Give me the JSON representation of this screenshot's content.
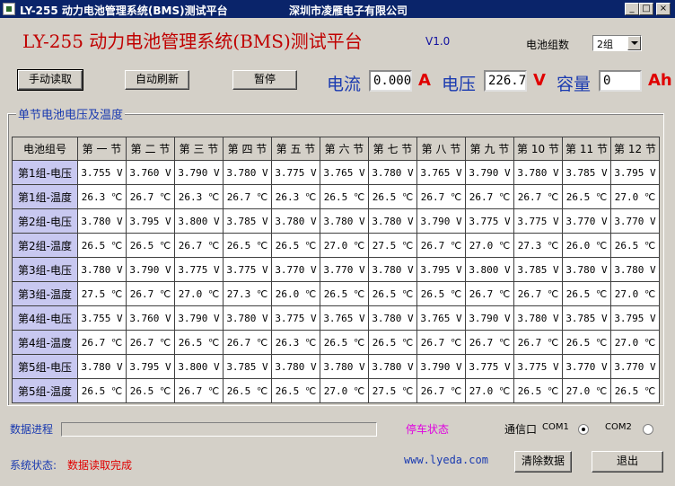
{
  "window": {
    "title": "LY-255 动力电池管理系统(BMS)测试平台",
    "company": "深圳市凌雁电子有限公司",
    "minimize": "_",
    "maximize": "□",
    "close": "×"
  },
  "header": {
    "big_title": "LY-255 动力电池管理系统(BMS)测试平台",
    "version": "V1.0",
    "group_count_label": "电池组数",
    "group_count_value": "2组"
  },
  "toolbar": {
    "manual_read": "手动读取",
    "auto_refresh": "自动刷新",
    "pause": "暂停"
  },
  "readings": {
    "current_label": "电流",
    "current_value": "0.000",
    "current_unit": "A",
    "voltage_label": "电压",
    "voltage_value": "226.7",
    "voltage_unit": "V",
    "capacity_label": "容量",
    "capacity_value": "0",
    "capacity_unit": "Ah"
  },
  "table": {
    "group_title": "单节电池电压及温度",
    "corner": "电池组号",
    "columns": [
      "第 一 节",
      "第 二 节",
      "第 三 节",
      "第 四 节",
      "第 五 节",
      "第 六 节",
      "第 七 节",
      "第 八 节",
      "第 九 节",
      "第 10 节",
      "第 11 节",
      "第 12 节"
    ],
    "rows": [
      {
        "label": "第1组-电压",
        "cells": [
          "3.755 V",
          "3.760 V",
          "3.790 V",
          "3.780 V",
          "3.775 V",
          "3.765 V",
          "3.780 V",
          "3.765 V",
          "3.790 V",
          "3.780 V",
          "3.785 V",
          "3.795 V"
        ]
      },
      {
        "label": "第1组-温度",
        "cells": [
          "26.3 ℃",
          "26.7 ℃",
          "26.3 ℃",
          "26.7 ℃",
          "26.3 ℃",
          "26.5 ℃",
          "26.5 ℃",
          "26.7 ℃",
          "26.7 ℃",
          "26.7 ℃",
          "26.5 ℃",
          "27.0 ℃"
        ]
      },
      {
        "label": "第2组-电压",
        "cells": [
          "3.780 V",
          "3.795 V",
          "3.800 V",
          "3.785 V",
          "3.780 V",
          "3.780 V",
          "3.780 V",
          "3.790 V",
          "3.775 V",
          "3.775 V",
          "3.770 V",
          "3.770 V"
        ]
      },
      {
        "label": "第2组-温度",
        "cells": [
          "26.5 ℃",
          "26.5 ℃",
          "26.7 ℃",
          "26.5 ℃",
          "26.5 ℃",
          "27.0 ℃",
          "27.5 ℃",
          "26.7 ℃",
          "27.0 ℃",
          "27.3 ℃",
          "26.0 ℃",
          "26.5 ℃"
        ]
      },
      {
        "label": "第3组-电压",
        "cells": [
          "3.780 V",
          "3.790 V",
          "3.775 V",
          "3.775 V",
          "3.770 V",
          "3.770 V",
          "3.780 V",
          "3.795 V",
          "3.800 V",
          "3.785 V",
          "3.780 V",
          "3.780 V"
        ]
      },
      {
        "label": "第3组-温度",
        "cells": [
          "27.5 ℃",
          "26.7 ℃",
          "27.0 ℃",
          "27.3 ℃",
          "26.0 ℃",
          "26.5 ℃",
          "26.5 ℃",
          "26.5 ℃",
          "26.7 ℃",
          "26.7 ℃",
          "26.5 ℃",
          "27.0 ℃"
        ]
      },
      {
        "label": "第4组-电压",
        "cells": [
          "3.755 V",
          "3.760 V",
          "3.790 V",
          "3.780 V",
          "3.775 V",
          "3.765 V",
          "3.780 V",
          "3.765 V",
          "3.790 V",
          "3.780 V",
          "3.785 V",
          "3.795 V"
        ]
      },
      {
        "label": "第4组-温度",
        "cells": [
          "26.7 ℃",
          "26.7 ℃",
          "26.5 ℃",
          "26.7 ℃",
          "26.3 ℃",
          "26.5 ℃",
          "26.5 ℃",
          "26.7 ℃",
          "26.7 ℃",
          "26.7 ℃",
          "26.5 ℃",
          "27.0 ℃"
        ]
      },
      {
        "label": "第5组-电压",
        "cells": [
          "3.780 V",
          "3.795 V",
          "3.800 V",
          "3.785 V",
          "3.780 V",
          "3.780 V",
          "3.780 V",
          "3.790 V",
          "3.775 V",
          "3.775 V",
          "3.770 V",
          "3.770 V"
        ]
      },
      {
        "label": "第5组-温度",
        "cells": [
          "26.5 ℃",
          "26.5 ℃",
          "26.7 ℃",
          "26.5 ℃",
          "26.5 ℃",
          "27.0 ℃",
          "27.5 ℃",
          "26.7 ℃",
          "27.0 ℃",
          "26.5 ℃",
          "27.0 ℃",
          "26.5 ℃"
        ]
      }
    ]
  },
  "footer": {
    "progress_label": "数据进程",
    "stop_status": "停车状态",
    "comm_label": "通信口",
    "com1": "COM1",
    "com2": "COM2",
    "com1_selected": true,
    "system_status_label": "系统状态:",
    "system_status_value": "数据读取完成",
    "website": "www.lyeda.com",
    "clear_button": "清除数据",
    "exit_button": "退出"
  },
  "colors": {
    "title_bar": "#0a246a",
    "big_title": "#c00000",
    "label_blue": "#1a3ab0",
    "unit_red": "#e00000",
    "row_header": "#c8c8f0",
    "stop_status": "#e000e0",
    "system_status": "#e00000"
  }
}
